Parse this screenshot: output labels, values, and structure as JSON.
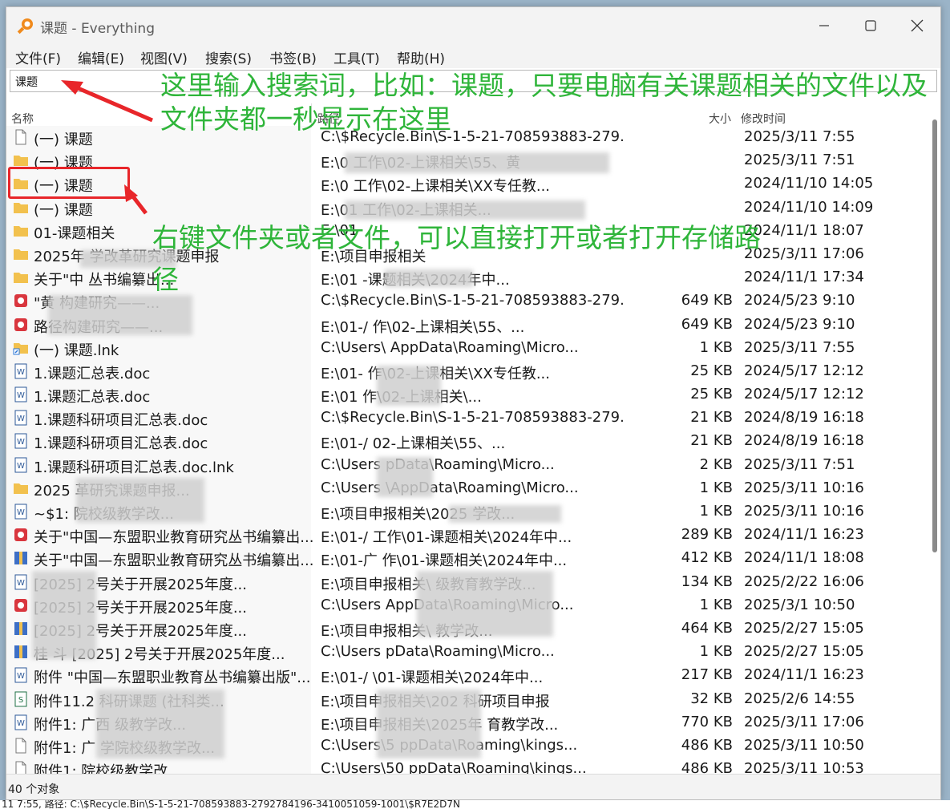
{
  "window": {
    "title": "课题 - Everything"
  },
  "menu": [
    "文件(F)",
    "编辑(E)",
    "视图(V)",
    "搜索(S)",
    "书签(B)",
    "工具(T)",
    "帮助(H)"
  ],
  "search": {
    "value": "课题"
  },
  "columns": {
    "name": "名称",
    "path": "路径",
    "size": "大小",
    "modified": "修改时间"
  },
  "rows": [
    {
      "icon": "file",
      "name": "(一) 课题",
      "path": "C:\\$Recycle.Bin\\S-1-5-21-708593883-279...",
      "size": "",
      "time": "2025/3/11 7:55"
    },
    {
      "icon": "folder",
      "name": "(一) 课题",
      "path": "E:\\0 工作\\02-上课相关\\55、黄",
      "size": "",
      "time": "2025/3/11 7:51"
    },
    {
      "icon": "folder",
      "name": "(一) 课题",
      "path": "E:\\0 工作\\02-上课相关\\XX专任教...",
      "size": "",
      "time": "2024/11/10 14:05"
    },
    {
      "icon": "folder",
      "name": "(一) 课题",
      "path": "E:\\01 工作\\02-上课相关...",
      "size": "",
      "time": "2024/11/10 14:09"
    },
    {
      "icon": "folder",
      "name": "01-课题相关",
      "path": "E:\\01",
      "size": "",
      "time": "2024/11/1 18:07"
    },
    {
      "icon": "folder",
      "name": "2025年 学改革研究课题申报",
      "path": "E:\\项目申报相关",
      "size": "",
      "time": "2025/3/11 17:06"
    },
    {
      "icon": "folder",
      "name": "关于\"中 丛书编纂出...",
      "path": "E:\\01 -课题相关\\2024年中...",
      "size": "",
      "time": "2024/11/1 17:34"
    },
    {
      "icon": "pdf",
      "name": "\"黄 构建研究——...",
      "path": "C:\\$Recycle.Bin\\S-1-5-21-708593883-279...",
      "size": "649 KB",
      "time": "2024/5/23 9:10"
    },
    {
      "icon": "pdf",
      "name": "路径构建研究——...",
      "path": "E:\\01-/ 作\\02-上课相关\\55、...",
      "size": "649 KB",
      "time": "2024/5/23 9:10"
    },
    {
      "icon": "shortcut",
      "name": "(一) 课题.lnk",
      "path": "C:\\Users\\ AppData\\Roaming\\Micro...",
      "size": "1 KB",
      "time": "2025/3/11 7:55"
    },
    {
      "icon": "word",
      "name": "1.课题汇总表.doc",
      "path": "E:\\01- 作\\02-上课相关\\XX专任教...",
      "size": "25 KB",
      "time": "2024/5/17 12:12"
    },
    {
      "icon": "word",
      "name": "1.课题汇总表.doc",
      "path": "E:\\01 作\\02-上课相关\\...",
      "size": "25 KB",
      "time": "2024/5/17 12:12"
    },
    {
      "icon": "word",
      "name": "1.课题科研项目汇总表.doc",
      "path": "C:\\$Recycle.Bin\\S-1-5-21-708593883-279...",
      "size": "21 KB",
      "time": "2024/8/19 16:18"
    },
    {
      "icon": "word",
      "name": "1.课题科研项目汇总表.doc",
      "path": "E:\\01-/ 02-上课相关\\55、...",
      "size": "21 KB",
      "time": "2024/8/19 16:18"
    },
    {
      "icon": "word",
      "name": "1.课题科研项目汇总表.doc.lnk",
      "path": "C:\\Users pData\\Roaming\\Micro...",
      "size": "2 KB",
      "time": "2025/3/11 7:51"
    },
    {
      "icon": "folder",
      "name": "2025 革研究课题申报...",
      "path": "C:\\Users \\AppData\\Roaming\\Micro...",
      "size": "1 KB",
      "time": "2025/3/11 10:16"
    },
    {
      "icon": "word",
      "name": "~$1: 院校级教学改...",
      "path": "E:\\项目申报相关\\2025 学改...",
      "size": "1 KB",
      "time": "2025/3/11 10:16"
    },
    {
      "icon": "pdf",
      "name": "关于\"中国—东盟职业教育研究丛书编纂出...",
      "path": "E:\\01-/ 工作\\01-课题相关\\2024年中...",
      "size": "289 KB",
      "time": "2024/11/1 16:23"
    },
    {
      "icon": "archive",
      "name": "关于\"中国—东盟职业教育研究丛书编纂出...",
      "path": "E:\\01-广 作\\01-课题相关\\2024年中...",
      "size": "412 KB",
      "time": "2024/11/1 18:08"
    },
    {
      "icon": "word",
      "name": "[2025] 2号关于开展2025年度...",
      "path": "E:\\项目申报相关\\ 级教育教学改...",
      "size": "134 KB",
      "time": "2025/2/22 16:06"
    },
    {
      "icon": "pdf",
      "name": "[2025] 2号关于开展2025年度...",
      "path": "C:\\Users AppData\\Roaming\\Micro...",
      "size": "1 KB",
      "time": "2025/3/1 10:50"
    },
    {
      "icon": "archive",
      "name": "[2025] 2号关于开展2025年度...",
      "path": "E:\\项目申报相关\\ 教学改...",
      "size": "464 KB",
      "time": "2025/2/27 15:05"
    },
    {
      "icon": "archive",
      "name": "桂 斗 [2025] 2号关于开展2025年度...",
      "path": "C:\\Users pData\\Roaming\\Micro...",
      "size": "1 KB",
      "time": "2025/2/27 15:05"
    },
    {
      "icon": "word",
      "name": "附件 \"中国—东盟职业教育丛书编纂出版\"...",
      "path": "E:\\01-/ \\01-课题相关\\2024年中...",
      "size": "217 KB",
      "time": "2024/11/1 16:23"
    },
    {
      "icon": "sheet",
      "name": "附件11.2 科研课题 (社科类...",
      "path": "E:\\项目申报相关\\202 科研项目申报",
      "size": "32 KB",
      "time": "2025/2/6 14:55"
    },
    {
      "icon": "word",
      "name": "附件1: 广西 级教学改...",
      "path": "E:\\项目申报相关\\2025年 育教学改...",
      "size": "770 KB",
      "time": "2025/3/11 17:06"
    },
    {
      "icon": "file",
      "name": "附件1: 广 学院校级教学改...",
      "path": "C:\\Users\\5 ppData\\Roaming\\kings...",
      "size": "486 KB",
      "time": "2025/3/11 10:50"
    },
    {
      "icon": "file",
      "name": "附件1: 院校级教学改...",
      "path": "C:\\Users\\50 ppData\\Roaming\\kings...",
      "size": "486 KB",
      "time": "2025/3/11 10:53"
    }
  ],
  "status": {
    "count": "40 个对象"
  },
  "bottom_strip": "11 7:55, 路径: C:\\$Recycle.Bin\\S-1-5-21-708593883-2792784196-3410051059-1001\\$R7E2D7N",
  "annotations": {
    "search_line1": "这里输入搜索词，比如：课题，只要电脑有关课题相关的文件以及",
    "search_line2": "文件夹都一秒显示在这里",
    "context_line1": "右键文件夹或者文件，可以直接打开或者打开存储路",
    "context_line2": "径"
  },
  "colors": {
    "annotation": "#2fb53a",
    "highlight": "#e8262a",
    "folder": "#f2c14e",
    "pdf": "#d9363e",
    "word": "#2b5797",
    "excel": "#1e7145"
  }
}
